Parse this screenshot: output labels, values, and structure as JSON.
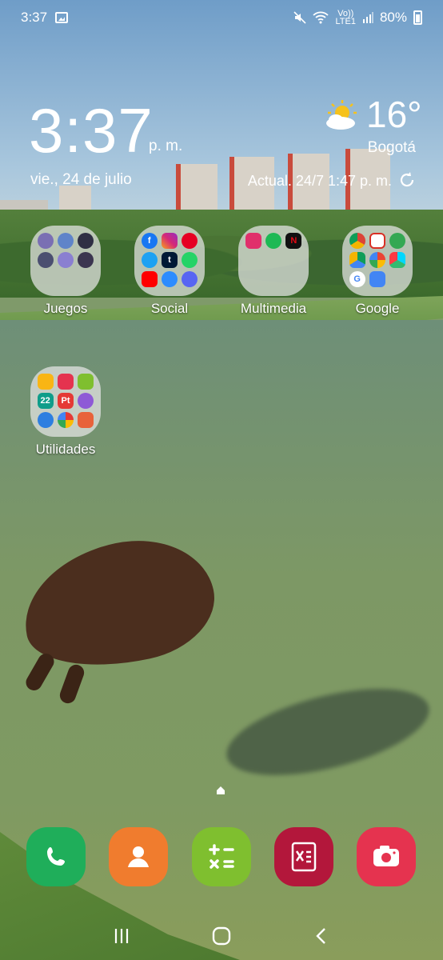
{
  "status_bar": {
    "time": "3:37",
    "volte_label": "Vo))",
    "lte_label": "LTE1",
    "battery": "80%"
  },
  "clock_widget": {
    "time": "3:37",
    "ampm": "p. m.",
    "date": "vie., 24 de julio"
  },
  "weather_widget": {
    "temperature": "16°",
    "city": "Bogotá",
    "updated": "Actual. 24/7 1:47 p. m."
  },
  "folders": [
    {
      "label": "Juegos",
      "apps": [
        "game-icon",
        "game-icon",
        "game-icon",
        "game-icon",
        "game-icon",
        "game-icon"
      ]
    },
    {
      "label": "Social",
      "apps": [
        "facebook-icon",
        "instagram-icon",
        "pinterest-icon",
        "twitter-icon",
        "tumblr-icon",
        "whatsapp-icon",
        "youtube-icon",
        "messenger-icon",
        "discord-icon"
      ]
    },
    {
      "label": "Multimedia",
      "apps": [
        "flower-icon",
        "spotify-icon",
        "netflix-icon"
      ]
    },
    {
      "label": "Google",
      "apps": [
        "chrome-icon",
        "gmail-icon",
        "maps-icon",
        "drive-icon",
        "photos-icon",
        "play-store-icon",
        "google-icon",
        "translate-icon"
      ]
    },
    {
      "label": "Utilidades",
      "apps": [
        "files-icon",
        "voice-recorder-icon",
        "calculator-icon",
        "calendar-icon",
        "pt-icon",
        "clock-icon",
        "translate-icon",
        "color-icon",
        "notes-icon"
      ]
    }
  ],
  "mini_text": {
    "tumblr": "t",
    "netflix": "N",
    "calendar": "22",
    "pt": "Pt",
    "google": "G",
    "facebook": "f"
  },
  "dock": [
    {
      "name": "phone-icon",
      "color": "#1fae5a"
    },
    {
      "name": "contacts-icon",
      "color": "#f07c2e"
    },
    {
      "name": "calculator-icon",
      "color": "#7fbf2f"
    },
    {
      "name": "excel-like-icon",
      "color": "#b3173b"
    },
    {
      "name": "camera-icon",
      "color": "#e5334f"
    }
  ]
}
